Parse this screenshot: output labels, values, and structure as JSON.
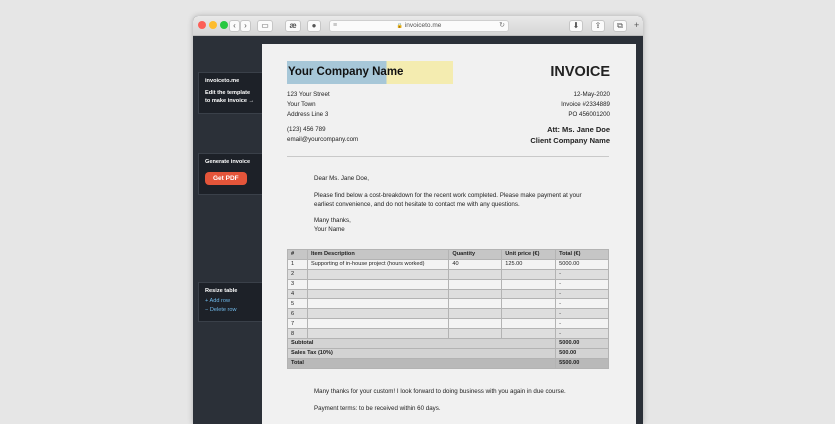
{
  "browser": {
    "url": "invoiceto.me",
    "ext_button_1": "æ",
    "ext_button_2": "●"
  },
  "sidebar": {
    "brand": "invoiceto.me",
    "edit_hint_1": "Edit the template",
    "edit_hint_2": "to make invoice →",
    "generate_title": "Generate invoice",
    "get_pdf_label": "Get PDF",
    "resize_title": "Resize table",
    "add_row_label": "+  Add row",
    "delete_row_label": "−  Delete row"
  },
  "invoice": {
    "company_name": "Your Company Name",
    "title": "INVOICE",
    "address": [
      "123 Your Street",
      "Your Town",
      "Address Line 3"
    ],
    "phone": "(123) 456 789",
    "email": "email@yourcompany.com",
    "date": "12-May-2020",
    "invoice_number": "Invoice #2334889",
    "po_number": "PO 456001200",
    "attention": "Att: Ms. Jane Doe",
    "client_company": "Client Company Name",
    "greeting": "Dear Ms. Jane Doe,",
    "body_line_1": "Please find below a cost-breakdown for the recent work completed. Please make payment at your",
    "body_line_2": "earliest convenience, and do not hesitate to contact me with any questions.",
    "signoff_1": "Many thanks,",
    "signoff_2": "Your Name",
    "closing_note": "Many thanks for your custom! I look forward to doing business with you again in due course.",
    "payment_terms": "Payment terms: to be received within 60 days."
  },
  "table": {
    "headers": [
      "#",
      "Item Description",
      "Quantity",
      "Unit price (€)",
      "Total (€)"
    ],
    "rows": [
      [
        "1",
        "Supporting of in-house project (hours worked)",
        "40",
        "125.00",
        "5000.00"
      ],
      [
        "2",
        "",
        "",
        "",
        "-"
      ],
      [
        "3",
        "",
        "",
        "",
        "-"
      ],
      [
        "4",
        "",
        "",
        "",
        "-"
      ],
      [
        "5",
        "",
        "",
        "",
        "-"
      ],
      [
        "6",
        "",
        "",
        "",
        "-"
      ],
      [
        "7",
        "",
        "",
        "",
        "-"
      ],
      [
        "8",
        "",
        "",
        "",
        "-"
      ]
    ],
    "subtotal_label": "Subtotal",
    "subtotal_value": "5000.00",
    "tax_label": "Sales Tax (10%)",
    "tax_value": "500.00",
    "total_label": "Total",
    "total_value": "5500.00"
  }
}
